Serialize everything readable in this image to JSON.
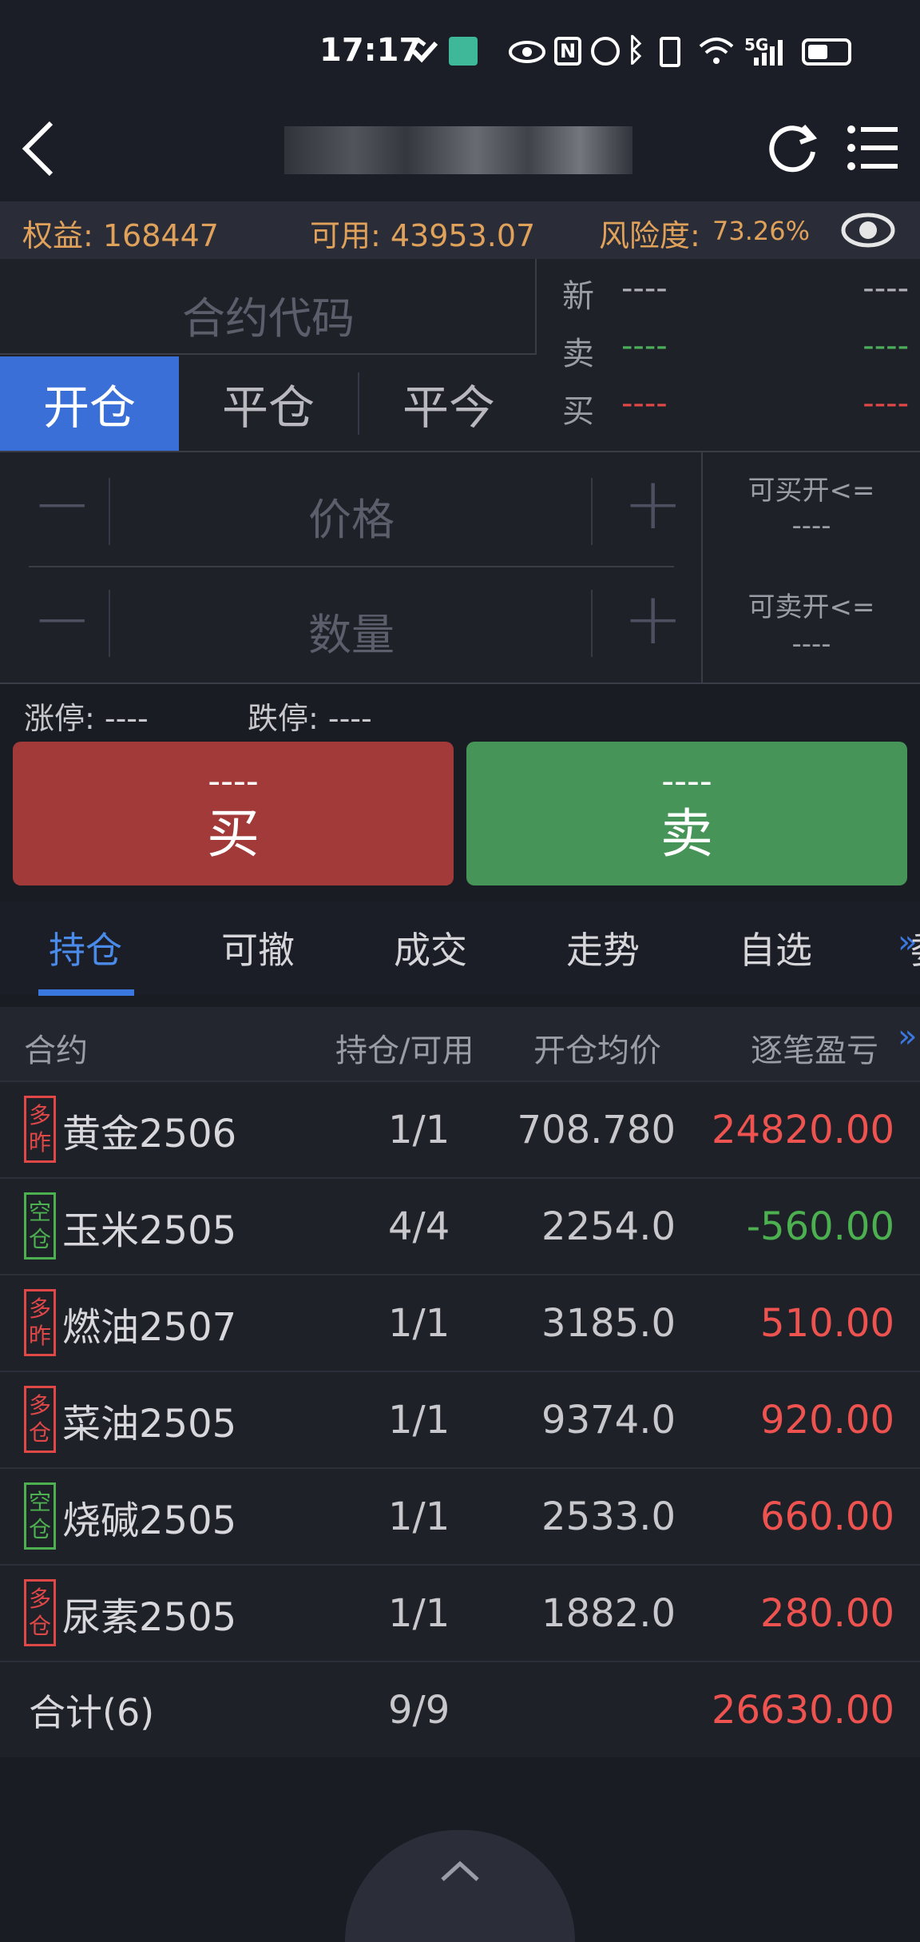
{
  "status_bar": {
    "time": "17:17",
    "network": "5G"
  },
  "nav": {
    "back_icon": "chevron-left-icon",
    "title": "",
    "refresh_icon": "refresh-icon",
    "menu_icon": "menu-icon"
  },
  "account": {
    "equity": "权益: 168447",
    "available": "可用: 43953.07",
    "risk_label": "风险度:",
    "risk_value": "73.26%"
  },
  "order": {
    "contract_placeholder": "合约代码",
    "tabs": [
      "开仓",
      "平仓",
      "平今"
    ],
    "quote": [
      {
        "label": "新",
        "left": "----",
        "right": "----",
        "color": "#b0b0b6"
      },
      {
        "label": "卖",
        "left": "----",
        "right": "----",
        "color": "#4cae5a"
      },
      {
        "label": "买",
        "left": "----",
        "right": "----",
        "color": "#e04848"
      }
    ],
    "price_placeholder": "价格",
    "qty_placeholder": "数量",
    "can_buy_label": "可买开<=",
    "can_buy_value": "----",
    "can_sell_label": "可卖开<=",
    "can_sell_value": "----",
    "limit_up": "涨停: ----",
    "limit_down": "跌停: ----",
    "buy_price": "----",
    "buy_label": "买",
    "sell_price": "----",
    "sell_label": "卖"
  },
  "bottom_tabs": [
    "持仓",
    "可撤",
    "成交",
    "走势",
    "自选",
    "委"
  ],
  "table": {
    "headers": [
      "合约",
      "持仓/可用",
      "开仓均价",
      "逐笔盈亏"
    ],
    "rows": [
      {
        "badge": [
          "多",
          "昨"
        ],
        "side": "long",
        "name": "黄金2506",
        "hold": "1/1",
        "price": "708.780",
        "pnl": "24820.00",
        "pnl_color": "#ef5350"
      },
      {
        "badge": [
          "空",
          "仓"
        ],
        "side": "short",
        "name": "玉米2505",
        "hold": "4/4",
        "price": "2254.0",
        "pnl": "-560.00",
        "pnl_color": "#4caf50"
      },
      {
        "badge": [
          "多",
          "昨"
        ],
        "side": "long",
        "name": "燃油2507",
        "hold": "1/1",
        "price": "3185.0",
        "pnl": "510.00",
        "pnl_color": "#ef5350"
      },
      {
        "badge": [
          "多",
          "仓"
        ],
        "side": "long",
        "name": "菜油2505",
        "hold": "1/1",
        "price": "9374.0",
        "pnl": "920.00",
        "pnl_color": "#ef5350"
      },
      {
        "badge": [
          "空",
          "仓"
        ],
        "side": "short",
        "name": "烧碱2505",
        "hold": "1/1",
        "price": "2533.0",
        "pnl": "660.00",
        "pnl_color": "#ef5350"
      },
      {
        "badge": [
          "多",
          "仓"
        ],
        "side": "long",
        "name": "尿素2505",
        "hold": "1/1",
        "price": "1882.0",
        "pnl": "280.00",
        "pnl_color": "#ef5350"
      }
    ],
    "total": {
      "label": "合计(6)",
      "hold": "9/9",
      "pnl": "26630.00"
    }
  },
  "colors": {
    "accent": "#3a6fd8",
    "up": "#ef5350",
    "down": "#4caf50",
    "orange": "#e0a15a"
  }
}
